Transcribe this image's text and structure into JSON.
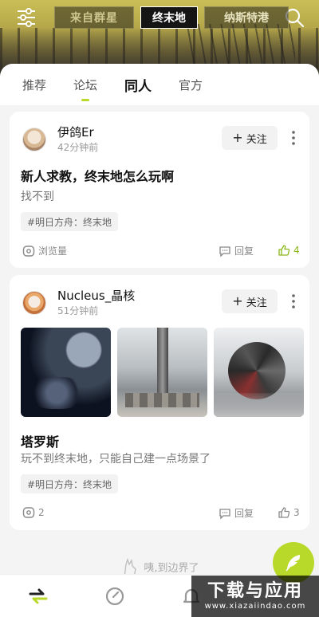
{
  "header": {
    "game_tabs": [
      {
        "label": "来自群星"
      },
      {
        "label": "终末地"
      },
      {
        "label": "纳斯特港"
      }
    ]
  },
  "nav": {
    "tabs": [
      {
        "label": "推荐"
      },
      {
        "label": "论坛"
      },
      {
        "label": "同人"
      },
      {
        "label": "官方"
      }
    ]
  },
  "posts": [
    {
      "author": "伊鸽Er",
      "time": "42分钟前",
      "follow_label": "关注",
      "follow_plus": "+",
      "title": "新人求教，终末地怎么玩啊",
      "body": "找不到",
      "tag": "#明日方舟：终末地",
      "views_label": "浏览量",
      "reply_label": "回复",
      "likes": "4"
    },
    {
      "author": "Nucleus_晶核",
      "time": "51分钟前",
      "follow_label": "关注",
      "follow_plus": "+",
      "title": "塔罗斯",
      "body": "玩不到终末地，只能自己建一点场景了",
      "tag": "#明日方舟：终末地",
      "views": "2",
      "reply_label": "回复",
      "likes": "3"
    }
  ],
  "end_note": "咦,到边界了",
  "watermark": {
    "big": "下载与应用",
    "small": "www.xiazaiindao.com"
  },
  "colors": {
    "accent": "#b8d92a",
    "liked": "#8ab81a"
  }
}
